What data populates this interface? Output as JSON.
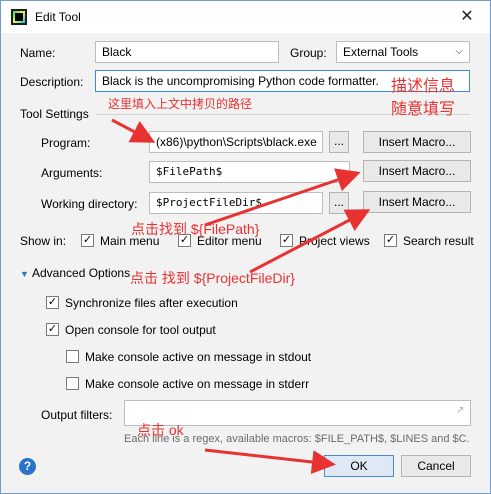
{
  "window": {
    "title": "Edit Tool",
    "close_icon": "close-icon"
  },
  "form": {
    "name_label": "Name:",
    "name_value": "Black",
    "group_label": "Group:",
    "group_value": "External Tools",
    "description_label": "Description:",
    "description_value": "Black is the uncompromising Python code formatter."
  },
  "tool_settings": {
    "section_label": "Tool Settings",
    "program_label": "Program:",
    "program_value": "(x86)\\python\\Scripts\\black.exe",
    "arguments_label": "Arguments:",
    "arguments_value": "$FilePath$",
    "working_dir_label": "Working directory:",
    "working_dir_value": "$ProjectFileDir$",
    "browse_label": "...",
    "insert_macro_label": "Insert Macro..."
  },
  "show_in": {
    "label": "Show in:",
    "items": [
      {
        "label": "Main menu",
        "checked": true
      },
      {
        "label": "Editor menu",
        "checked": true
      },
      {
        "label": "Project views",
        "checked": true
      },
      {
        "label": "Search result",
        "checked": true
      }
    ]
  },
  "advanced": {
    "section_label": "Advanced Options",
    "sync_label": "Synchronize files after execution",
    "open_console_label": "Open console for tool output",
    "active_stdout_label": "Make console active on message in stdout",
    "active_stderr_label": "Make console active on message in stderr",
    "output_filters_label": "Output filters:",
    "hint": "Each line is a regex, available macros: $FILE_PATH$, $LINES and $C..."
  },
  "footer": {
    "ok_label": "OK",
    "cancel_label": "Cancel",
    "help_label": "?"
  },
  "annotations": {
    "desc_note_1": "描述信息",
    "desc_note_2": "随意填写",
    "path_note": "这里填入上文中拷贝的路径",
    "filepath_note": "点击找到 ${FilePath}",
    "projectdir_note": "点击 找到 ${ProjectFileDir}",
    "ok_note": "点击 ok"
  },
  "colors": {
    "annotation": "#e83232",
    "focus_border": "#3c8adf",
    "primary_border": "#4a8ad6"
  }
}
